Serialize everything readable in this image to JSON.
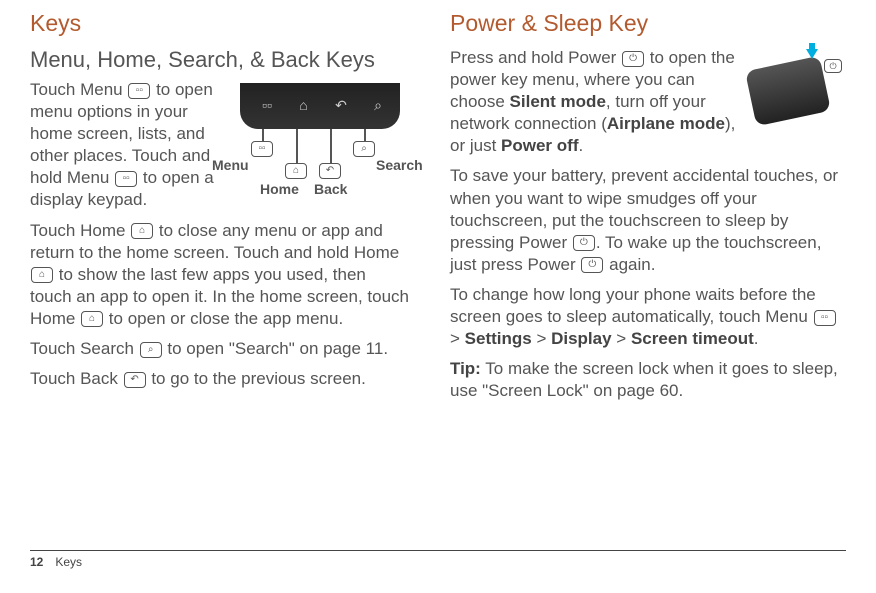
{
  "left": {
    "h1": "Keys",
    "h2": "Menu, Home, Search, & Back Keys",
    "p1a": "Touch Menu ",
    "p1b": " to open menu options in your home screen, lists, and other places. Touch and hold Menu ",
    "p1c": " to open a display keypad.",
    "p2a": "Touch  Home ",
    "p2b": " to close any menu or app and return to the home screen. Touch and hold Home ",
    "p2c": " to show the last few apps you used, then touch an app to open it. In the home screen, touch Home ",
    "p2d": " to open or close the app menu.",
    "p3a": "Touch Search ",
    "p3b": " to open \"Search\" on page 11.",
    "p4a": "Touch Back ",
    "p4b": " to go to the previous screen.",
    "diagram": {
      "menu": "Menu",
      "home": "Home",
      "back": "Back",
      "search": "Search"
    }
  },
  "right": {
    "h1": "Power & Sleep Key",
    "p1a": "Press and hold Power ",
    "p1b": " to open the power key menu, where you can choose ",
    "p1c": "Silent mode",
    "p1d": ", turn off your network connection (",
    "p1e": "Airplane mode",
    "p1f": "), or just ",
    "p1g": "Power off",
    "p1h": ".",
    "p2a": "To save your battery, prevent accidental touches, or when you want to wipe smudges off your touchscreen, put the touchscreen to sleep by pressing Power ",
    "p2b": ". To wake up the touchscreen, just press Power ",
    "p2c": " again.",
    "p3a": "To change how long your phone waits before the screen goes to sleep automatically, touch Menu ",
    "p3b": " > ",
    "p3c": "Settings",
    "p3d": " > ",
    "p3e": "Display",
    "p3f": " > ",
    "p3g": "Screen timeout",
    "p3h": ".",
    "p4a": "Tip:",
    "p4b": " To make the screen lock when it goes to sleep, use \"Screen Lock\" on page 60."
  },
  "footer": {
    "page": "12",
    "section": "Keys"
  },
  "icons": {
    "menu": "▫▫",
    "home": "⌂",
    "back": "↶",
    "search": "⌕",
    "power": "⏻"
  }
}
